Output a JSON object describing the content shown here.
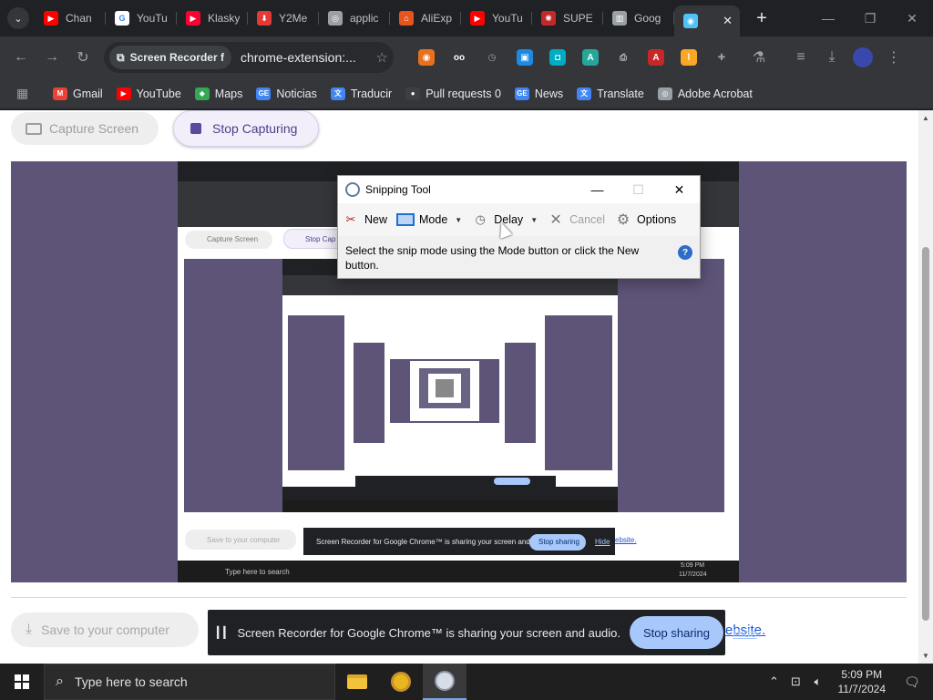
{
  "browser": {
    "tabs": [
      {
        "label": "Chan",
        "color": "#ff0000",
        "glyph": "▶"
      },
      {
        "label": "YouTu",
        "color": "#ffffff",
        "glyph": "G"
      },
      {
        "label": "Klasky",
        "color": "#ff0033",
        "glyph": "▶"
      },
      {
        "label": "Y2Me",
        "color": "#e53935",
        "glyph": "⬇"
      },
      {
        "label": "applic",
        "color": "#9aa0a6",
        "glyph": "◎"
      },
      {
        "label": "AliExp",
        "color": "#e8541e",
        "glyph": "⌂"
      },
      {
        "label": "YouTu",
        "color": "#ff0000",
        "glyph": "▶"
      },
      {
        "label": "SUPE",
        "color": "#c62828",
        "glyph": "✺"
      },
      {
        "label": "Goog",
        "color": "#9aa0a6",
        "glyph": "▥"
      }
    ],
    "active_tab": {
      "label": "",
      "close": "✕"
    },
    "new_tab": "+",
    "omnibox": {
      "chip": "Screen Recorder f",
      "url": "chrome-extension:..."
    },
    "bookmarks": [
      {
        "label": "Gmail",
        "color": "#ea4335",
        "glyph": "M"
      },
      {
        "label": "YouTube",
        "color": "#ff0000",
        "glyph": "▶"
      },
      {
        "label": "Maps",
        "color": "#34a853",
        "glyph": "◆"
      },
      {
        "label": "Noticias",
        "color": "#4285f4",
        "glyph": "GE"
      },
      {
        "label": "Traducir",
        "color": "#4285f4",
        "glyph": "文"
      },
      {
        "label": "Pull requests 0",
        "color": "#3c4043",
        "glyph": "●"
      },
      {
        "label": "News",
        "color": "#4285f4",
        "glyph": "GE"
      },
      {
        "label": "Translate",
        "color": "#4285f4",
        "glyph": "文"
      },
      {
        "label": "Adobe Acrobat",
        "color": "#9aa0a6",
        "glyph": "◎"
      }
    ],
    "extensions": [
      {
        "color": "#e8711e",
        "glyph": "◉"
      },
      {
        "color": "#ffffff",
        "glyph": "oo"
      },
      {
        "color": "#9aa0a6",
        "glyph": "◷"
      },
      {
        "color": "#1e88e5",
        "glyph": "▣"
      },
      {
        "color": "#00acc1",
        "glyph": "◘"
      },
      {
        "color": "#26a69a",
        "glyph": "A"
      },
      {
        "color": "#bdbdbd",
        "glyph": "⎙"
      },
      {
        "color": "#c62828",
        "glyph": "A"
      },
      {
        "color": "#f9a825",
        "glyph": "⌇"
      },
      {
        "color": "#9aa0a6",
        "glyph": "✚"
      }
    ]
  },
  "recorder": {
    "capture_label": "Capture Screen",
    "stop_label": "Stop Capturing",
    "save_label": "Save to your computer",
    "website_label": "ebsite."
  },
  "sharing": {
    "message": "Screen Recorder for Google Chrome™ is sharing your screen and audio.",
    "stop_label": "Stop sharing",
    "hide_label": "Hide"
  },
  "snipping": {
    "title": "Snipping Tool",
    "new_label": "New",
    "mode_label": "Mode",
    "delay_label": "Delay",
    "cancel_label": "Cancel",
    "options_label": "Options",
    "hint": "Select the snip mode using the Mode button or click the New button.",
    "help": "?"
  },
  "inner": {
    "capture_label": "Capture Screen",
    "stop_label": "Stop Cap",
    "save_label": "Save to your computer",
    "share_msg": "Screen Recorder for Google Chrome™ is sharing your screen and audio.",
    "stop_label2": "Stop sharing",
    "hide_label": "Hide",
    "website_label": "ebsite.",
    "search": "Type here to search",
    "time": "5:09 PM",
    "date": "11/7/2024"
  },
  "taskbar": {
    "search_placeholder": "Type here to search",
    "time": "5:09 PM",
    "date": "11/7/2024"
  }
}
